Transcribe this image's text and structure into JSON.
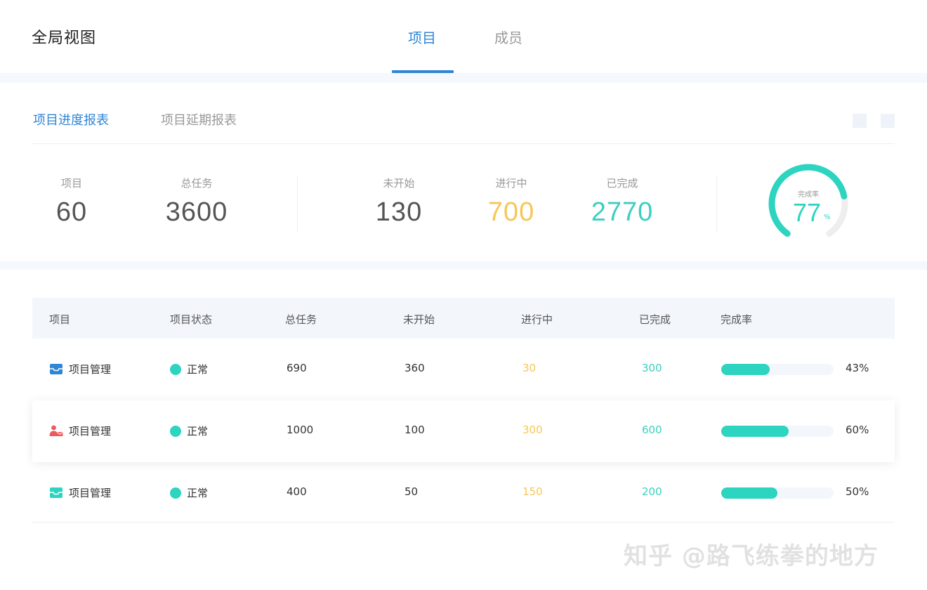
{
  "header": {
    "title": "全局视图",
    "tabs": [
      {
        "label": "项目",
        "active": true
      },
      {
        "label": "成员",
        "active": false
      }
    ]
  },
  "report": {
    "tabs": [
      {
        "label": "项目进度报表",
        "active": true
      },
      {
        "label": "项目延期报表",
        "active": false
      }
    ],
    "stats": [
      {
        "label": "项目",
        "value": "60"
      },
      {
        "label": "总任务",
        "value": "3600"
      },
      {
        "label": "未开始",
        "value": "130"
      },
      {
        "label": "进行中",
        "value": "700"
      },
      {
        "label": "已完成",
        "value": "2770"
      }
    ],
    "gauge": {
      "label": "完成率",
      "value": "77",
      "unit": "%",
      "fraction": 0.77
    }
  },
  "table": {
    "columns": [
      "项目",
      "项目状态",
      "总任务",
      "未开始",
      "进行中",
      "已完成",
      "完成率"
    ],
    "rows": [
      {
        "icon": "inbox-icon",
        "icon_color": "#2f86d6",
        "name": "项目管理",
        "status": "正常",
        "total": "690",
        "not_started": "360",
        "in_progress": "30",
        "done": "300",
        "rate_label": "43%",
        "rate": 0.43
      },
      {
        "icon": "user-mail-icon",
        "icon_color": "#ec5b5b",
        "name": "项目管理",
        "status": "正常",
        "total": "1000",
        "not_started": "100",
        "in_progress": "300",
        "done": "600",
        "rate_label": "60%",
        "rate": 0.6
      },
      {
        "icon": "inbox-icon",
        "icon_color": "#2dd4bf",
        "name": "项目管理",
        "status": "正常",
        "total": "400",
        "not_started": "50",
        "in_progress": "150",
        "done": "200",
        "rate_label": "50%",
        "rate": 0.5
      }
    ]
  },
  "watermark": "知乎 @路飞练拳的地方",
  "colors": {
    "accent": "#2f86d6",
    "teal": "#2dd4bf",
    "amber": "#f6c659",
    "danger": "#ec5b5b"
  }
}
